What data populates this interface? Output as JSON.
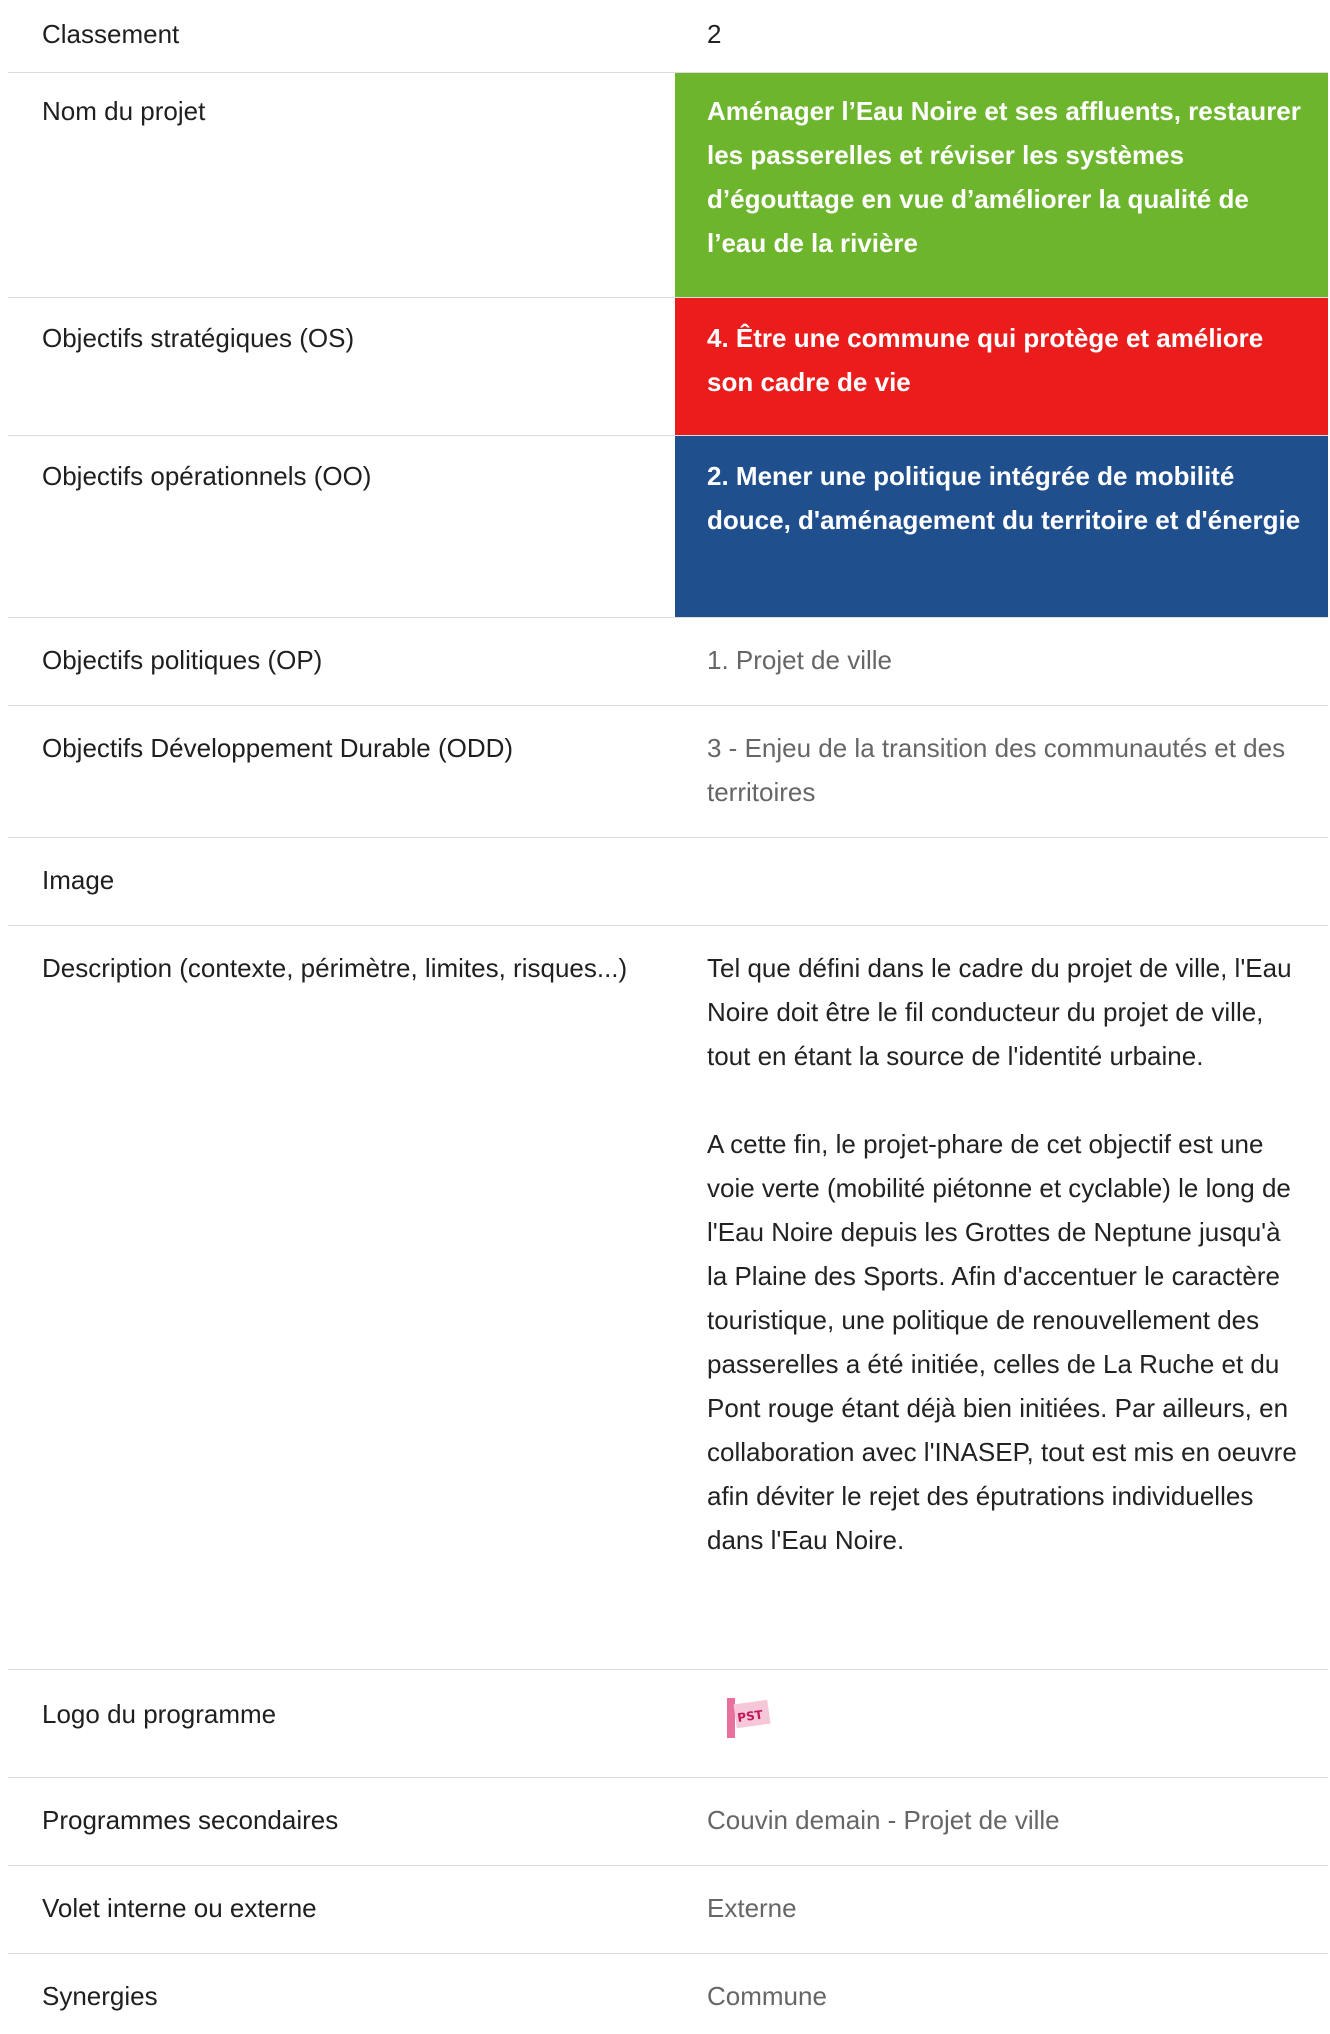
{
  "rows": {
    "classement": {
      "label": "Classement",
      "value": "2"
    },
    "nom_projet": {
      "label": "Nom du projet",
      "value": "Aménager l’Eau Noire et ses affluents, restaurer les passerelles et réviser les systèmes d’égouttage en vue d’améliorer la qualité de l’eau de la rivière"
    },
    "os": {
      "label": "Objectifs stratégiques (OS)",
      "value": "4. Être une commune qui protège et améliore son cadre de vie"
    },
    "oo": {
      "label": "Objectifs opérationnels (OO)",
      "value": "2. Mener une politique intégrée de mobilité douce, d'aménagement du territoire et d'énergie"
    },
    "op": {
      "label": "Objectifs politiques (OP)",
      "value": "1. Projet de ville"
    },
    "odd": {
      "label": "Objectifs Développement Durable (ODD)",
      "value": "3 - Enjeu de la transition des communautés et des territoires"
    },
    "image": {
      "label": "Image"
    },
    "description": {
      "label": "Description (contexte, périmètre, limites, risques...)",
      "paragraph1": "Tel que défini dans le cadre du projet de ville, l'Eau Noire doit être le fil conducteur du projet de ville, tout en étant la source de l'identité urbaine.",
      "paragraph2": "A cette fin, le projet-phare de cet objectif est une voie verte (mobilité piétonne et cyclable) le long de l'Eau Noire depuis les Grottes de Neptune jusqu'à la Plaine des Sports. Afin d'accentuer le caractère touristique, une politique de renouvellement des passerelles a été initiée, celles de La Ruche et du Pont rouge étant déjà bien initiées. Par ailleurs, en collaboration avec l'INASEP, tout est mis en oeuvre afin déviter le rejet des éputrations individuelles dans l'Eau Noire."
    },
    "logo": {
      "label": "Logo du programme",
      "logo_text": "PST"
    },
    "programmes": {
      "label": "Programmes secondaires",
      "value": "Couvin demain - Projet de ville"
    },
    "volet": {
      "label": "Volet interne ou externe",
      "value": "Externe"
    },
    "synergies": {
      "label": "Synergies",
      "value": "Commune"
    }
  },
  "colors": {
    "green": "#6cb52d",
    "red": "#ea1c1c",
    "blue": "#1f4f8d"
  }
}
